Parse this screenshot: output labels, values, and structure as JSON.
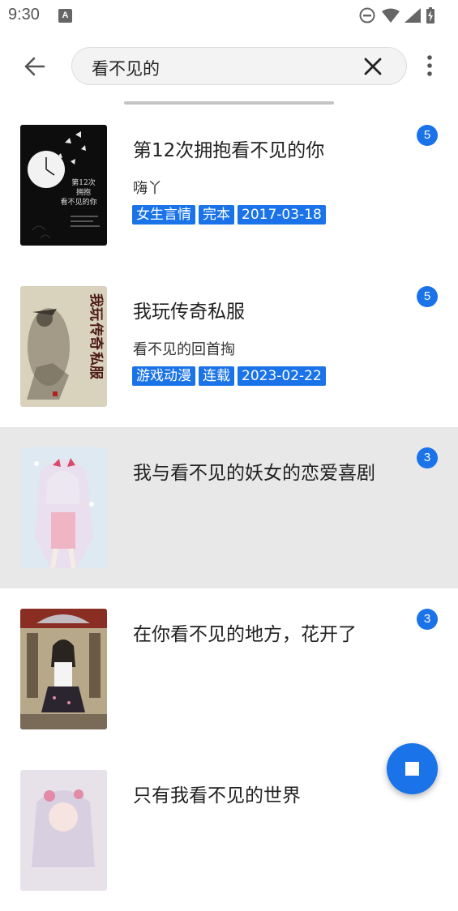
{
  "status_bar": {
    "time": "9:30",
    "notification_icon": "A"
  },
  "search": {
    "query": "看不见的"
  },
  "results": [
    {
      "title": "第12次拥抱看不见的你",
      "author": "嗨丫",
      "tags": [
        "女生言情",
        "完本",
        "2017-03-18"
      ],
      "badge": "5",
      "cover_lines": [
        "第12次",
        "拥抱",
        "看不见的你"
      ]
    },
    {
      "title": "我玩传奇私服",
      "author": "看不见的回首掏",
      "tags": [
        "游戏动漫",
        "连载",
        "2023-02-22"
      ],
      "badge": "5",
      "cover_lines": [
        "我玩",
        "传奇",
        "私服"
      ]
    },
    {
      "title": "我与看不见的妖女的恋爱喜剧",
      "author": "",
      "tags": [],
      "badge": "3",
      "cover_lines": []
    },
    {
      "title": "在你看不见的地方，花开了",
      "author": "",
      "tags": [],
      "badge": "3",
      "cover_lines": []
    },
    {
      "title": "只有我看不见的世界",
      "author": "",
      "tags": [],
      "badge": "",
      "cover_lines": []
    }
  ],
  "colors": {
    "accent": "#1a73e8",
    "highlight_row": "#e8e8e8"
  },
  "icons": {
    "back": "arrow-back-icon",
    "clear": "close-icon",
    "more": "more-vert-icon",
    "fab": "stop-icon"
  }
}
